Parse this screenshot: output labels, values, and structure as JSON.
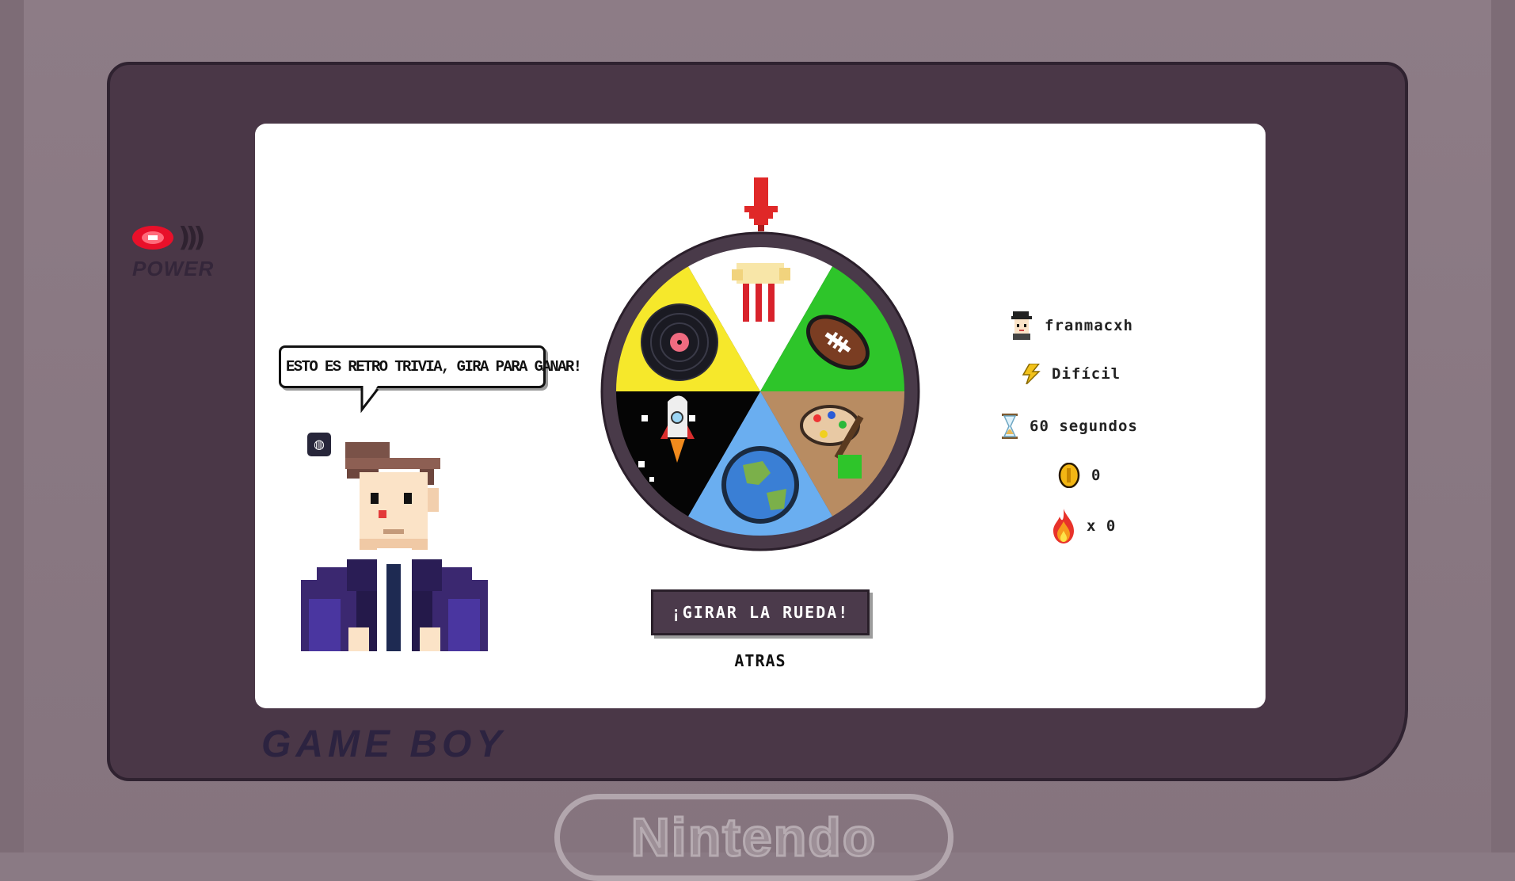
{
  "console": {
    "power_label": "POWER",
    "device_label": "GAME BOY",
    "brand_label": "Nintendo"
  },
  "host": {
    "speech": "ESTO ES RETRO TRIVIA, GIRA PARA GANAR!",
    "mute_badge": "◍"
  },
  "wheel": {
    "categories": [
      {
        "name": "cine-popcorn",
        "color": "#ffffff"
      },
      {
        "name": "deportes-football",
        "color": "#2ec52a"
      },
      {
        "name": "arte-palette",
        "color": "#b88c62"
      },
      {
        "name": "geografia-globe",
        "color": "#6aaef0"
      },
      {
        "name": "ciencia-rocket",
        "color": "#050505"
      },
      {
        "name": "musica-vinyl",
        "color": "#f6e82b"
      }
    ]
  },
  "controls": {
    "spin_label": "¡GIRAR LA RUEDA!",
    "back_label": "ATRAS"
  },
  "stats": {
    "username": "franmacxh",
    "difficulty": "Difícil",
    "time": "60 segundos",
    "coins": "0",
    "streak": "x  0"
  }
}
